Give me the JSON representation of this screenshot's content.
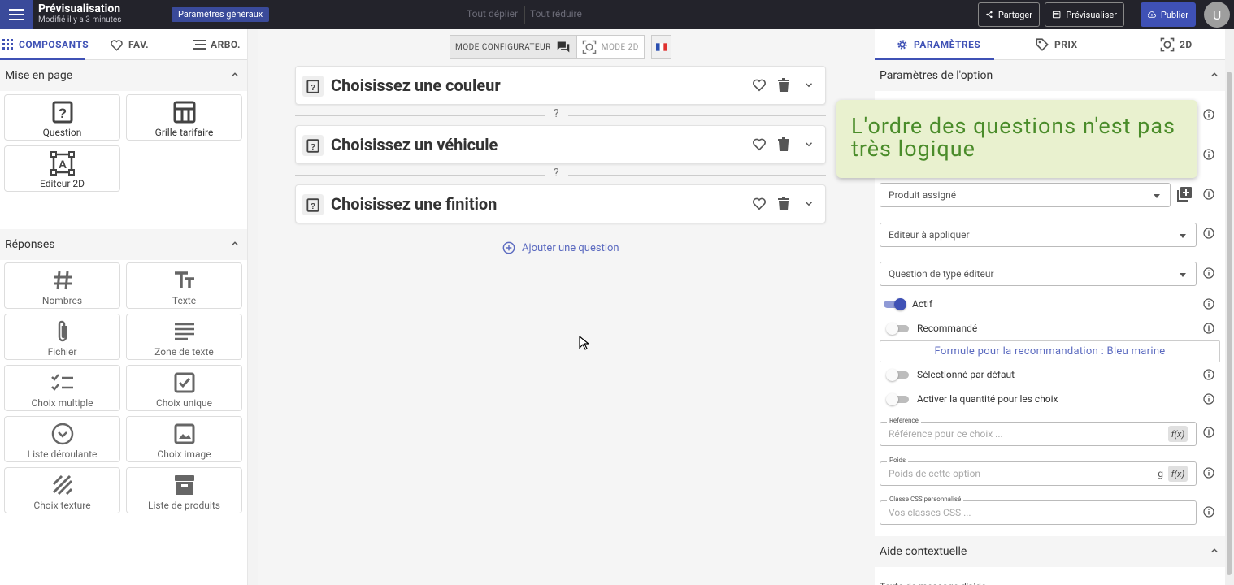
{
  "topbar": {
    "title": "Prévisualisation",
    "subtitle": "Modifié il y a 3 minutes",
    "params_label": "Paramètres généraux",
    "expand_all": "Tout déplier",
    "collapse_all": "Tout réduire",
    "share": "Partager",
    "preview": "Prévisualiser",
    "publish": "Publier",
    "avatar": "U"
  },
  "left_tabs": [
    "COMPOSANTS",
    "FAV.",
    "ARBO."
  ],
  "layout_section": {
    "title": "Mise en page",
    "items": [
      "Question",
      "Grille tarifaire",
      "Editeur 2D"
    ]
  },
  "responses_section": {
    "title": "Réponses",
    "items": [
      "Nombres",
      "Texte",
      "Fichier",
      "Zone de texte",
      "Choix multiple",
      "Choix unique",
      "Liste déroulante",
      "Choix image",
      "Choix texture",
      "Liste de produits"
    ]
  },
  "modes": {
    "configurator": "MODE CONFIGURATEUR",
    "mode2d": "MODE 2D"
  },
  "questions": [
    "Choisissez une couleur",
    "Choisissez un véhicule",
    "Choisissez une finition"
  ],
  "separator_symbol": "?",
  "add_question": "Ajouter une question",
  "right_tabs": [
    "PARAMÈTRES",
    "PRIX",
    "2D"
  ],
  "option_section": "Paramètres de l'option",
  "fields": {
    "assigned_product": "Produit assigné",
    "editor_to_apply": "Editeur à appliquer",
    "editor_question": "Question de type éditeur"
  },
  "toggles": {
    "active": "Actif",
    "recommended": "Recommandé",
    "default_selected": "Sélectionné par défaut",
    "quantity": "Activer la quantité pour les choix"
  },
  "formula_button": "Formule pour la recommandation : Bleu marine",
  "reference": {
    "label": "Référence",
    "placeholder": "Référence pour ce choix ..."
  },
  "weight": {
    "label": "Poids",
    "placeholder": "Poids de cette option",
    "unit": "g"
  },
  "css_class": {
    "label": "Classe CSS personnalisé",
    "placeholder": "Vos classes CSS ..."
  },
  "fx_label": "f(x)",
  "help_section": "Aide contextuelle",
  "help_partial": "Texte de message d'aide",
  "note": "L'ordre des questions n'est pas très logique",
  "colors": {
    "accent": "#3f51b5",
    "topbar": "#23232b",
    "note_bg": "#e9f1cf",
    "note_text": "#4a8c2a"
  }
}
